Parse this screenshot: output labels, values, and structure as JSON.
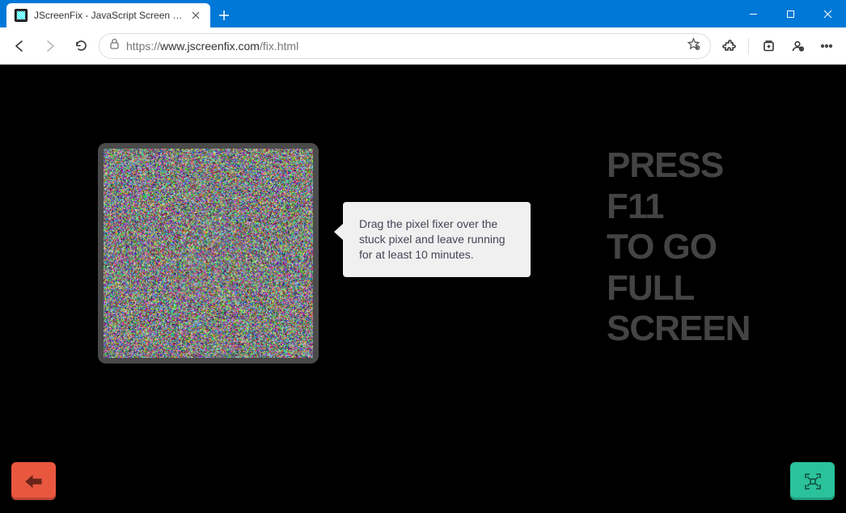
{
  "browser": {
    "tab_title": "JScreenFix - JavaScript Screen Pix",
    "url_proto": "https://",
    "url_host": "www.jscreenfix.com",
    "url_path": "/fix.html"
  },
  "tooltip": {
    "text": "Drag the pixel fixer over the stuck pixel and leave running for at least 10 minutes."
  },
  "fullscreen_hint": {
    "line1": "PRESS",
    "line2": "F11",
    "line3": "TO GO",
    "line4": "FULL",
    "line5": "SCREEN"
  }
}
